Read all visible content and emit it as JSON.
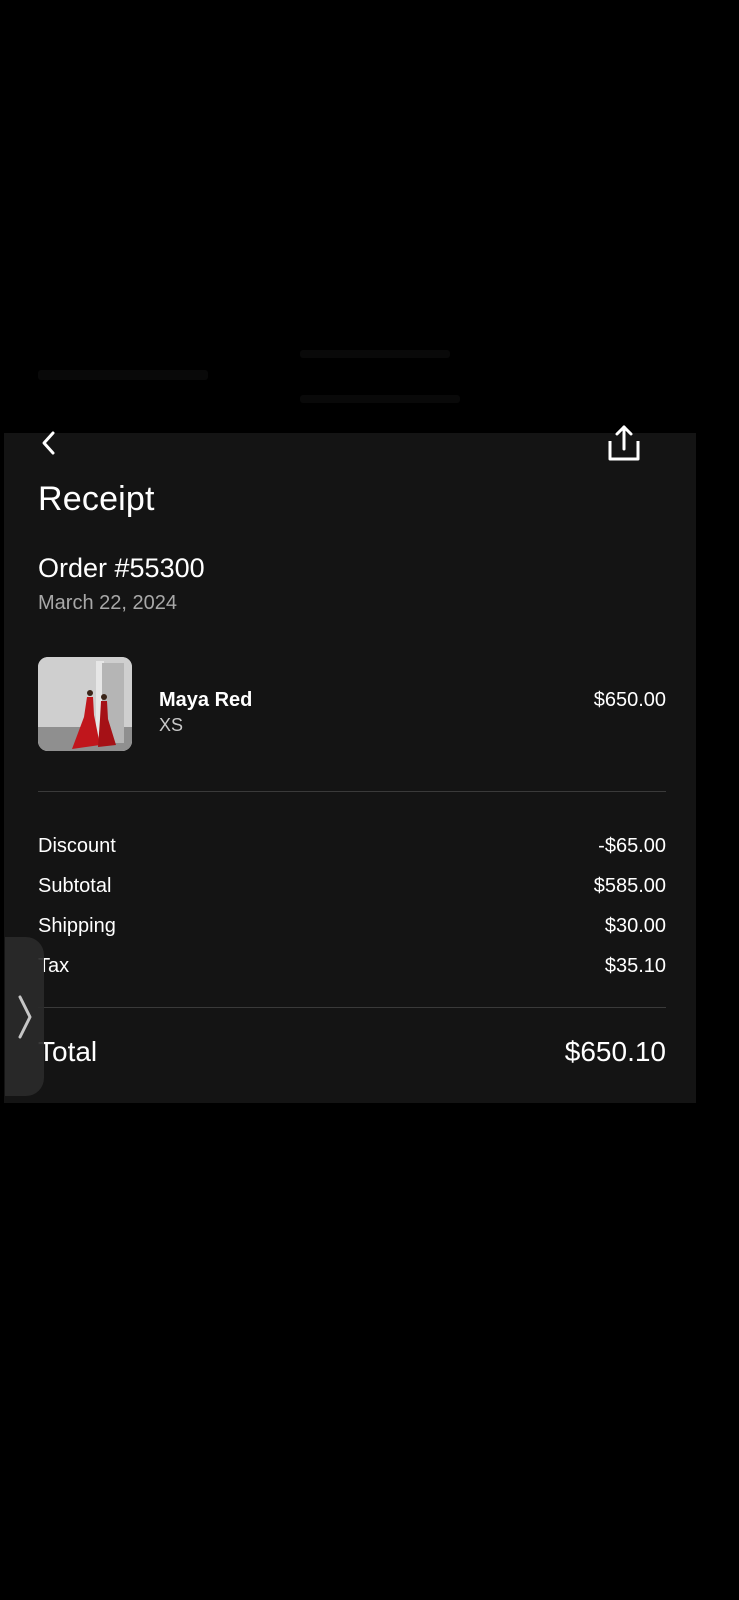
{
  "receipt": {
    "title": "Receipt",
    "order_number": "Order #55300",
    "order_date": "March 22, 2024",
    "item": {
      "name": "Maya Red",
      "size": "XS",
      "price": "$650.00"
    },
    "lines": [
      {
        "label": "Discount",
        "value": "-$65.00"
      },
      {
        "label": "Subtotal",
        "value": "$585.00"
      },
      {
        "label": "Shipping",
        "value": "$30.00"
      },
      {
        "label": "Tax",
        "value": "$35.10"
      }
    ],
    "total": {
      "label": "Total",
      "value": "$650.10"
    }
  },
  "icons": {
    "back": "chevron-left-icon",
    "share": "share-icon",
    "side_handle": "chevron-right-icon"
  },
  "colors": {
    "background": "#000000",
    "sheet": "#141414",
    "text": "#ffffff",
    "muted": "#a8a8a8",
    "divider": "#3a3a3a",
    "dress": "#c0161c"
  }
}
